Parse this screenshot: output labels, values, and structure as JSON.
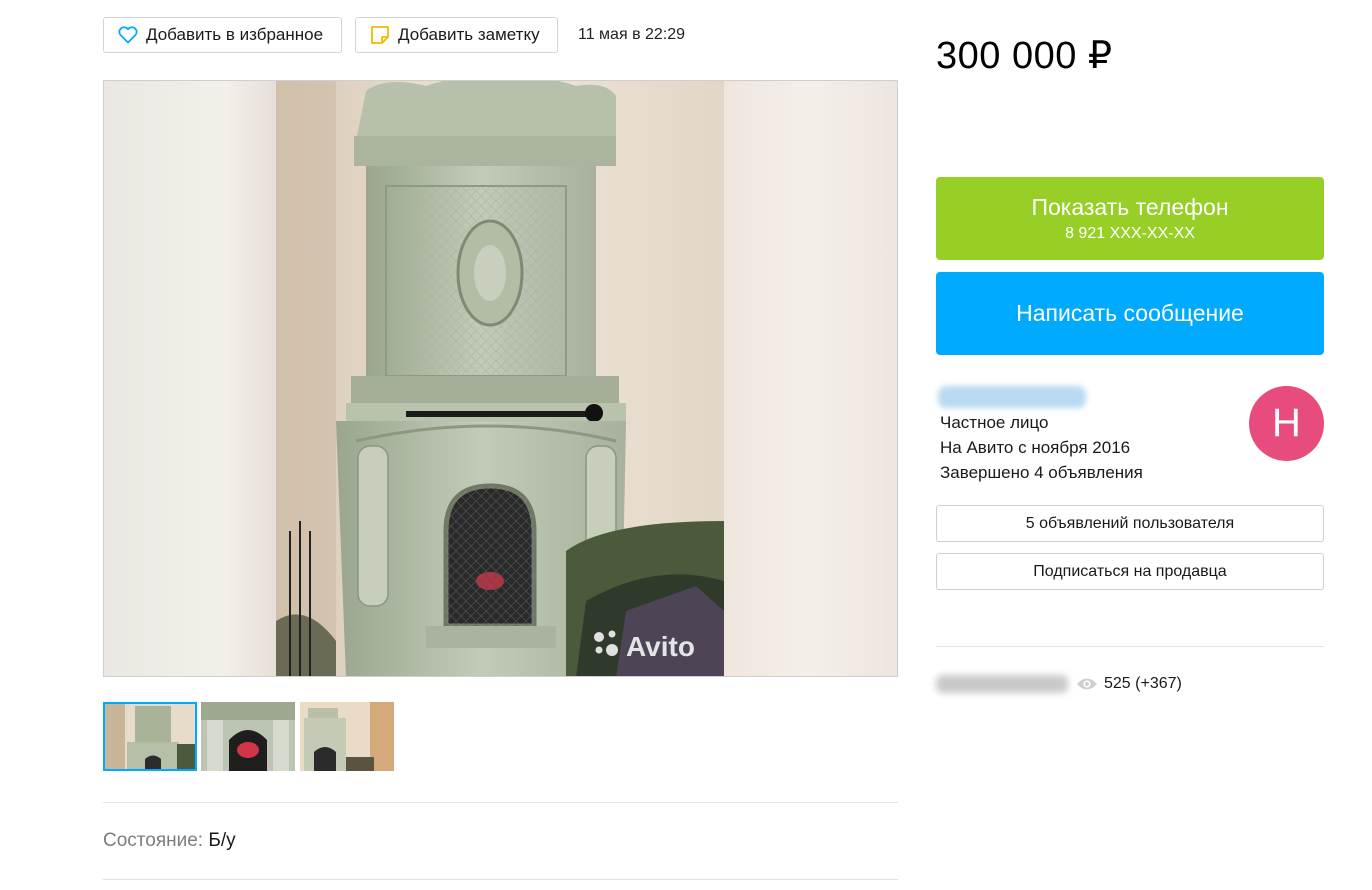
{
  "actions": {
    "favorite_label": "Добавить в избранное",
    "note_label": "Добавить заметку",
    "date": "11 мая в 22:29"
  },
  "gallery": {
    "watermark": "Avito",
    "thumbnails": [
      "photo-1",
      "photo-2",
      "photo-3"
    ],
    "selected_index": 0
  },
  "params": {
    "condition_label": "Состояние:",
    "condition_value": "Б/у"
  },
  "sidebar": {
    "price": "300 000 ₽",
    "phone_button": {
      "label": "Показать телефон",
      "number": "8 921 XXX-XX-XX"
    },
    "message_button": "Написать сообщение",
    "seller": {
      "type": "Частное лицо",
      "since": "На Авито с ноября 2016",
      "completed": "Завершено 4 объявления",
      "avatar_letter": "Н"
    },
    "user_ads_button": "5 объявлений пользователя",
    "subscribe_button": "Подписаться на продавца",
    "views": "525 (+367)"
  },
  "colors": {
    "phone_button": "#97cf26",
    "message_button": "#00aaff",
    "avatar": "#e84c7c",
    "icon_accent": "#00aaff",
    "note_icon": "#f5b700"
  }
}
